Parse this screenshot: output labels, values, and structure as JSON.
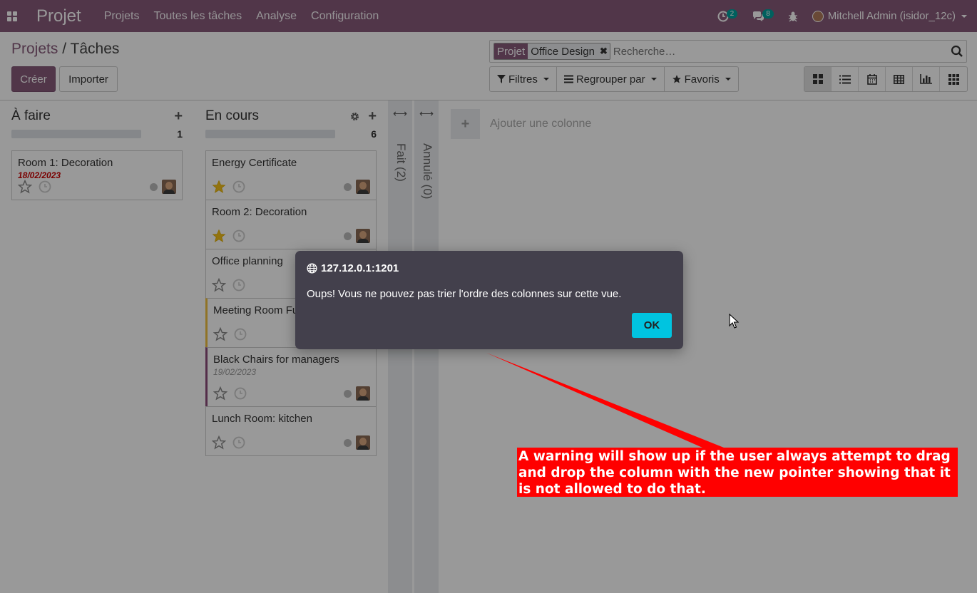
{
  "navbar": {
    "app_name": "Projet",
    "menu": [
      "Projets",
      "Toutes les tâches",
      "Analyse",
      "Configuration"
    ],
    "activity_count": "2",
    "messages_count": "8",
    "user": "Mitchell Admin (isidor_12c)"
  },
  "control": {
    "breadcrumb_parent": "Projets",
    "breadcrumb_sep": "/",
    "breadcrumb_current": "Tâches",
    "create_label": "Créer",
    "import_label": "Importer",
    "facet_label": "Projet",
    "facet_value": "Office Design",
    "search_placeholder": "Recherche…",
    "filters_label": "Filtres",
    "groupby_label": "Regrouper par",
    "favorites_label": "Favoris"
  },
  "kanban": {
    "columns": [
      {
        "title": "À faire",
        "count": "1",
        "cards": [
          {
            "title": "Room 1: Decoration",
            "date": "18/02/2023",
            "starred": false
          }
        ]
      },
      {
        "title": "En cours",
        "count": "6",
        "cards": [
          {
            "title": "Energy Certificate",
            "starred": true
          },
          {
            "title": "Room 2: Decoration",
            "starred": true
          },
          {
            "title": "Office planning",
            "starred": false
          },
          {
            "title": "Meeting Room Furniture",
            "starred": false
          },
          {
            "title": "Black Chairs for managers",
            "date": "19/02/2023",
            "starred": false
          },
          {
            "title": "Lunch Room: kitchen",
            "starred": false
          }
        ]
      }
    ],
    "folded": [
      {
        "label": "Fait (2)"
      },
      {
        "label": "Annulé (0)"
      }
    ],
    "add_column_label": "Ajouter une colonne"
  },
  "dialog": {
    "origin": "127.12.0.1:1201",
    "message": "Oups! Vous ne pouvez pas trier l'ordre des colonnes sur cette vue.",
    "ok_label": "OK"
  },
  "annotation": {
    "text": "A warning will show up if the user always attempt to drag and drop the column with the new pointer showing that it is not allowed to do that."
  },
  "colors": {
    "brand": "#875a7b",
    "ok_button": "#00c4e0",
    "annotation": "#ff0000",
    "star": "#f3c01a"
  }
}
